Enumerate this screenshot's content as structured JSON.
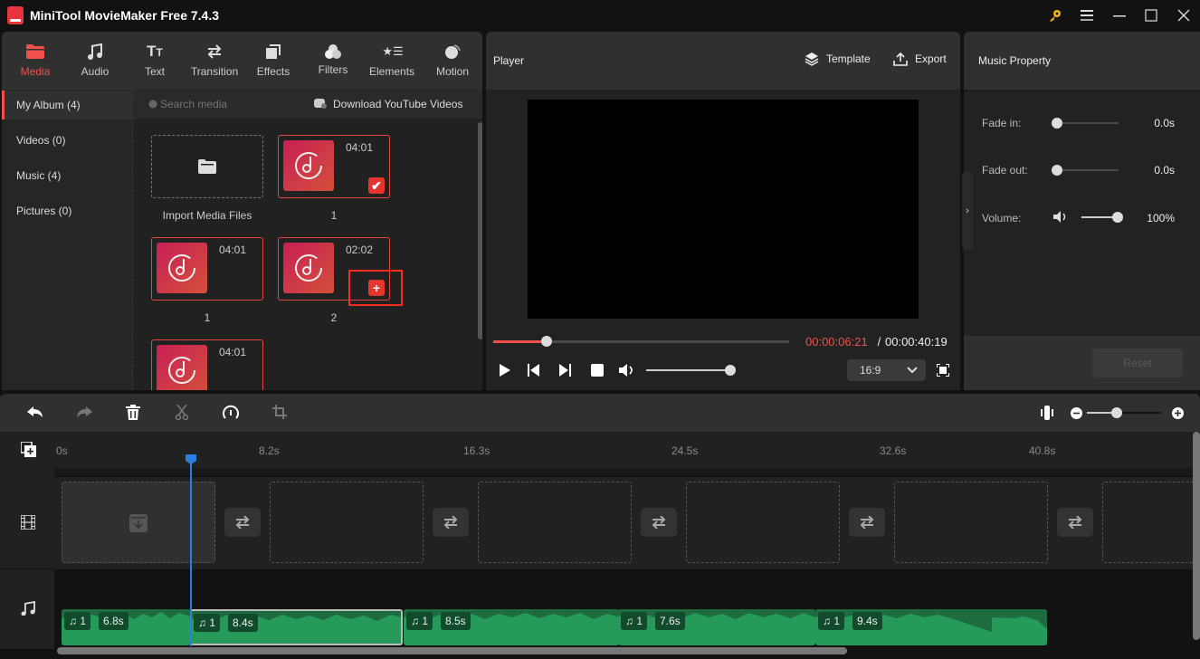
{
  "app": {
    "title": "MiniTool MovieMaker Free 7.4.3",
    "window_controls": [
      "key-icon",
      "menu-icon",
      "minimize-icon",
      "maximize-icon",
      "close-icon"
    ]
  },
  "toolbar": {
    "tabs": [
      {
        "label": "Media",
        "icon": "folder-icon",
        "active": true
      },
      {
        "label": "Audio",
        "icon": "music-note-icon"
      },
      {
        "label": "Text",
        "icon": "text-icon"
      },
      {
        "label": "Transition",
        "icon": "transition-icon"
      },
      {
        "label": "Effects",
        "icon": "effects-icon"
      },
      {
        "label": "Filters",
        "icon": "filters-icon"
      },
      {
        "label": "Elements",
        "icon": "elements-icon"
      },
      {
        "label": "Motion",
        "icon": "motion-icon"
      }
    ]
  },
  "sidebar": {
    "items": [
      {
        "label": "My Album (4)",
        "active": true
      },
      {
        "label": "Videos (0)"
      },
      {
        "label": "Music (4)"
      },
      {
        "label": "Pictures (0)"
      }
    ]
  },
  "media": {
    "search_placeholder": "Search media",
    "download_label": "Download YouTube Videos",
    "import_label": "Import Media Files",
    "items": [
      {
        "name": "1",
        "duration": "04:01",
        "badge": "check"
      },
      {
        "name": "1",
        "duration": "04:01",
        "badge": null
      },
      {
        "name": "2",
        "duration": "02:02",
        "badge": "add"
      },
      {
        "name": "",
        "duration": "04:01",
        "badge": null
      }
    ]
  },
  "player": {
    "title": "Player",
    "template_label": "Template",
    "export_label": "Export",
    "current_time": "00:00:06:21",
    "separator": " / ",
    "total_time": "00:00:40:19",
    "progress_percent": 18,
    "volume_percent": 100,
    "aspect_ratio": "16:9"
  },
  "properties": {
    "title": "Music Property",
    "fade_in_label": "Fade in:",
    "fade_in_value": "0.0s",
    "fade_out_label": "Fade out:",
    "fade_out_value": "0.0s",
    "volume_label": "Volume:",
    "volume_value": "100%",
    "reset_label": "Reset"
  },
  "timeline": {
    "toolbar_icons": [
      "undo-icon",
      "redo-icon",
      "delete-icon",
      "split-icon",
      "speed-icon",
      "crop-icon"
    ],
    "zoom_level_percent": 40,
    "ruler_ticks": [
      "0s",
      "8.2s",
      "16.3s",
      "24.5s",
      "32.6s",
      "40.8s"
    ],
    "playhead_time": "6.8s",
    "audio_clips": [
      {
        "track": "1",
        "duration": "6.8s",
        "selected": false
      },
      {
        "track": "1",
        "duration": "8.4s",
        "selected": true
      },
      {
        "track": "1",
        "duration": "8.5s",
        "selected": false
      },
      {
        "track": "1",
        "duration": "7.6s",
        "selected": false
      },
      {
        "track": "1",
        "duration": "9.4s",
        "selected": false
      }
    ]
  },
  "colors": {
    "accent": "#f2504a",
    "audio_clip": "#269a58",
    "playhead": "#2c7fe0",
    "key": "#f5b50a"
  }
}
